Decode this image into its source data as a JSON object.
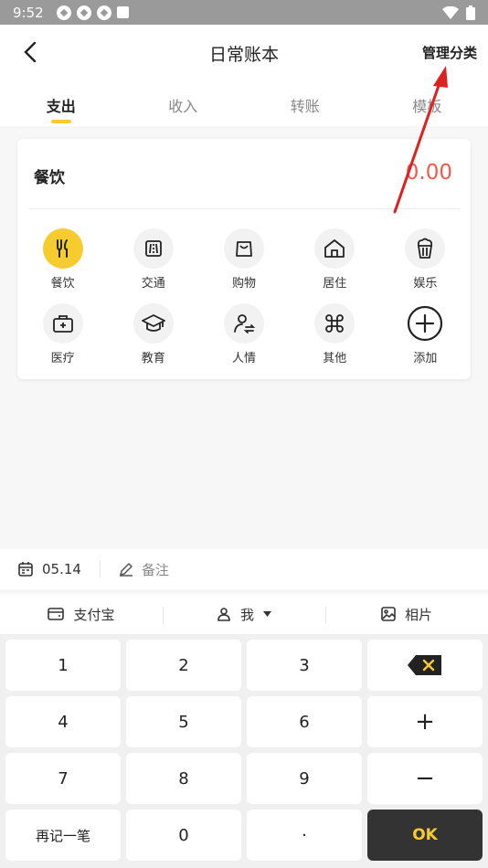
{
  "status_bar": {
    "time": "9:52"
  },
  "header": {
    "title": "日常账本",
    "manage_label": "管理分类"
  },
  "tabs": [
    {
      "label": "支出",
      "active": true
    },
    {
      "label": "收入",
      "active": false
    },
    {
      "label": "转账",
      "active": false
    },
    {
      "label": "模板",
      "active": false
    }
  ],
  "card": {
    "selected_category": "餐饮",
    "amount": "0.00",
    "categories": [
      {
        "label": "餐饮",
        "icon": "cutlery-icon",
        "active": true
      },
      {
        "label": "交通",
        "icon": "road-icon"
      },
      {
        "label": "购物",
        "icon": "shopping-bag-icon"
      },
      {
        "label": "居住",
        "icon": "home-icon"
      },
      {
        "label": "娱乐",
        "icon": "popcorn-icon"
      },
      {
        "label": "医疗",
        "icon": "medical-kit-icon"
      },
      {
        "label": "教育",
        "icon": "graduation-cap-icon"
      },
      {
        "label": "人情",
        "icon": "person-transfer-icon"
      },
      {
        "label": "其他",
        "icon": "command-icon"
      },
      {
        "label": "添加",
        "icon": "add-circle-icon"
      }
    ]
  },
  "meta": {
    "date": "05.14",
    "note_placeholder": "备注"
  },
  "payment": {
    "account": "支付宝",
    "member": "我",
    "photo": "相片"
  },
  "keypad": {
    "keys": [
      "1",
      "2",
      "3",
      "",
      "4",
      "5",
      "6",
      "+",
      "7",
      "8",
      "9",
      "−",
      "再记一笔",
      "0",
      "·",
      "OK"
    ]
  },
  "colors": {
    "accent": "#f7cc2f",
    "amount": "#f05a4a",
    "annotation": "#e02020"
  }
}
